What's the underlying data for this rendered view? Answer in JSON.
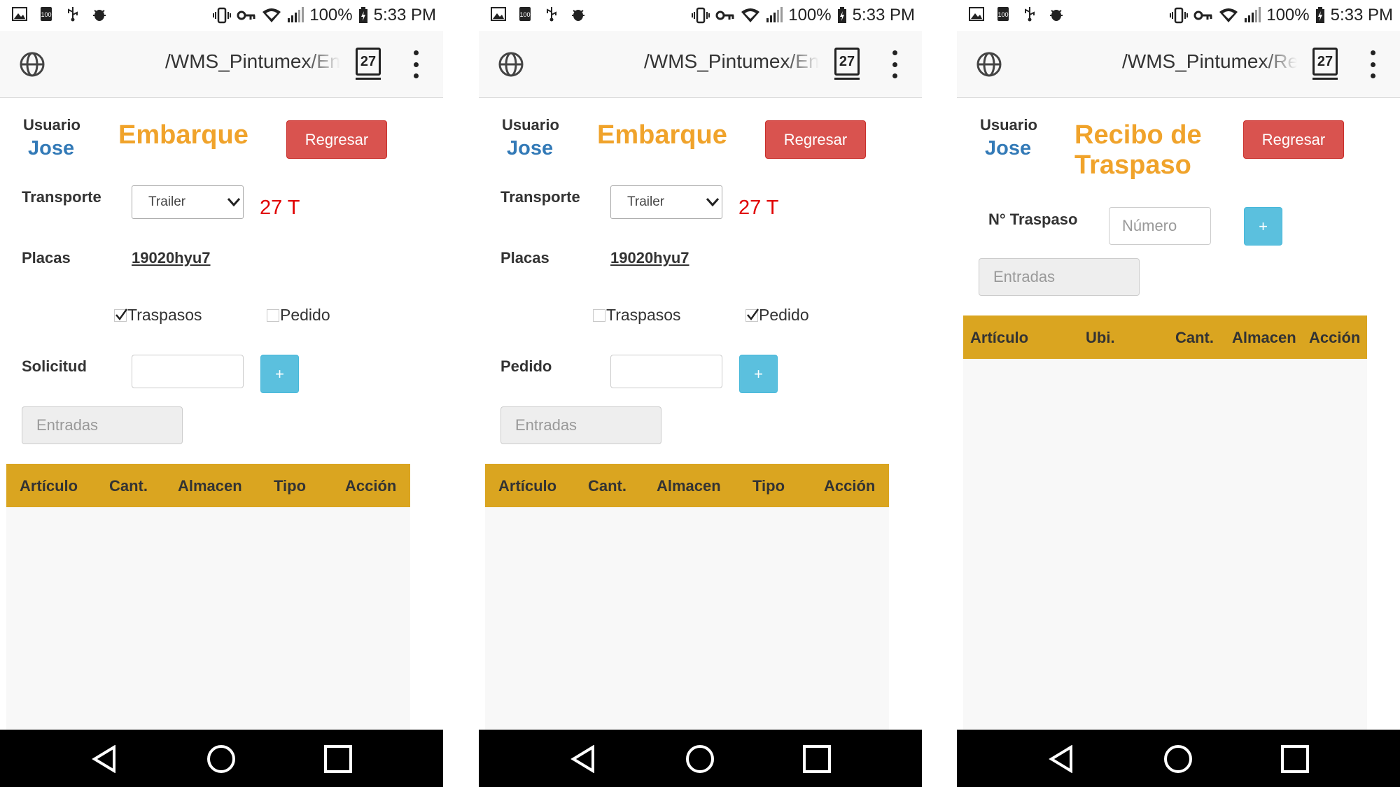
{
  "status_bar": {
    "battery": "100%",
    "time": "5:33 PM"
  },
  "browser": {
    "tab_count": "27"
  },
  "screens": [
    {
      "url": "/WMS_Pintumex/En",
      "user_label": "Usuario",
      "user_name": "Jose",
      "title": "Embarque",
      "back_button": "Regresar",
      "transport_label": "Transporte",
      "transport_value": "Trailer",
      "transport_count": "27 T",
      "plates_label": "Placas",
      "plates_value": "19020hyu7",
      "option_transfers": "Traspasos",
      "option_transfers_checked": true,
      "option_order": "Pedido",
      "option_order_checked": false,
      "request_label": "Solicitud",
      "request_value": "",
      "add_button": "+",
      "entries_button": "Entradas",
      "columns": [
        "Artículo",
        "Cant.",
        "Almacen",
        "Tipo",
        "Acción"
      ]
    },
    {
      "url": "/WMS_Pintumex/En",
      "user_label": "Usuario",
      "user_name": "Jose",
      "title": "Embarque",
      "back_button": "Regresar",
      "transport_label": "Transporte",
      "transport_value": "Trailer",
      "transport_count": "27 T",
      "plates_label": "Placas",
      "plates_value": "19020hyu7",
      "option_transfers": "Traspasos",
      "option_transfers_checked": false,
      "option_order": "Pedido",
      "option_order_checked": true,
      "request_label": "Pedido",
      "request_value": "",
      "add_button": "+",
      "entries_button": "Entradas",
      "columns": [
        "Artículo",
        "Cant.",
        "Almacen",
        "Tipo",
        "Acción"
      ]
    },
    {
      "url": "/WMS_Pintumex/Re",
      "user_label": "Usuario",
      "user_name": "Jose",
      "title_line1": "Recibo de",
      "title_line2": "Traspaso",
      "back_button": "Regresar",
      "transfer_label": "N° Traspaso",
      "transfer_placeholder": "Número",
      "add_button": "+",
      "entries_button": "Entradas",
      "columns": [
        "Artículo",
        "Ubi.",
        "Cant.",
        "Almacen",
        "Acción"
      ]
    }
  ],
  "colors": {
    "accent_orange": "#f0a32b",
    "danger": "#d9534f",
    "info": "#5bc0de",
    "table_header": "#daa520",
    "user_blue": "#337ab7",
    "count_red": "#e00000"
  },
  "icons": [
    "gallery-icon",
    "data-saver-icon",
    "usb-icon",
    "bug-icon",
    "vibrate-icon",
    "vpn-key-icon",
    "wifi-icon",
    "signal-icon",
    "battery-icon",
    "globe-icon",
    "tabs-icon",
    "overflow-menu-icon",
    "back-nav-icon",
    "home-nav-icon",
    "recents-nav-icon",
    "checkmark-icon",
    "chevron-down-icon"
  ]
}
